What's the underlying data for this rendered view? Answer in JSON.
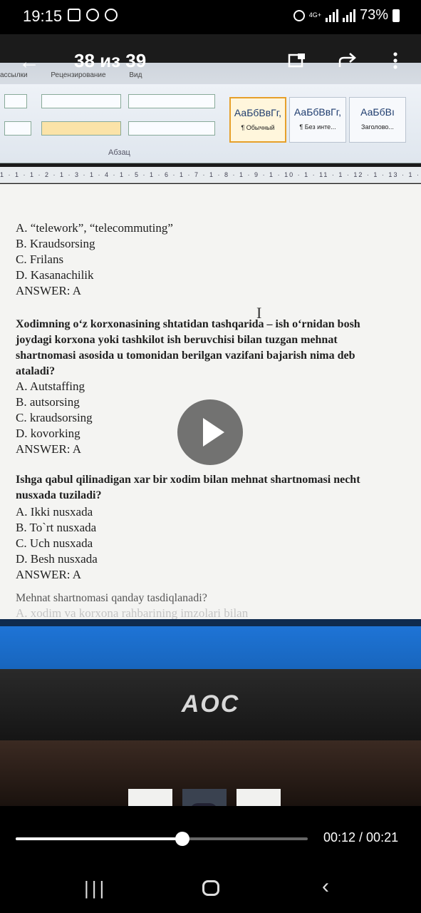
{
  "status_bar": {
    "time": "19:15",
    "network": "4G+",
    "battery": "73%"
  },
  "viewer": {
    "counter": "38 из 39"
  },
  "photo": {
    "ribbon": {
      "tab_1": "ассылки",
      "tab_2": "Рецензирование",
      "tab_3": "Вид",
      "group_label": "Абзац",
      "styles": [
        {
          "preview": "АаБбВвГг,",
          "name": "¶ Обычный"
        },
        {
          "preview": "АаБбВвГг,",
          "name": "¶ Без инте..."
        },
        {
          "preview": "АаБбВı",
          "name": "Заголово..."
        }
      ],
      "ruler": "1 · 1 · 1 · 2 · 1 · 3 · 1 · 4 · 1 · 5 · 1 · 6 · 1 · 7 · 1 · 8 · 1 · 9 · 1 · 10 · 1 · 11 · 1 · 12 · 1 · 13 · 1 · 14"
    },
    "document": {
      "block1": {
        "a": "A. “telework”, “telecommuting”",
        "b": "B. Kraudsorsing",
        "c": "C. Frilans",
        "d": "D. Kasanachilik",
        "answer": "ANSWER: A"
      },
      "block2": {
        "q1": "Xodimning o‘z korxonasining shtatidan tashqarida – ish o‘rnidan bosh",
        "q2": "joydagi korxona yoki tashkilot ish beruvchisi bilan tuzgan mehnat",
        "q3": "shartnomasi asosida u tomonidan berilgan vazifani bajarish nima deb",
        "q4": "ataladi?",
        "a": "A. Autstaffing",
        "b": "B. autsorsing",
        "c": "C. kraudsorsing",
        "d": "D. kovorking",
        "answer": "ANSWER: A"
      },
      "block3": {
        "q1": "Ishga qabul qilinadigan xar bir xodim bilan mehnat shartnomasi necht",
        "q2": "nusxada tuziladi?",
        "a": "A. Ikki nusxada",
        "b": "B. To`rt nusxada",
        "c": "C. Uch nusxada",
        "d": "D. Besh nusxada",
        "answer": "ANSWER: A"
      },
      "block4": {
        "q1": "Mehnat shartnomasi qanday tasdiqlanadi?",
        "a": "A. xodim va korxona rahbarining imzolari bilan"
      }
    },
    "monitor_brand": "AOC"
  },
  "playback": {
    "time": "00:12 / 00:21",
    "progress": 0.571
  },
  "icons": {
    "back": "arrow-left-icon",
    "cast": "cast-icon",
    "share": "share-icon",
    "more": "more-vert-icon",
    "play": "play-icon"
  }
}
